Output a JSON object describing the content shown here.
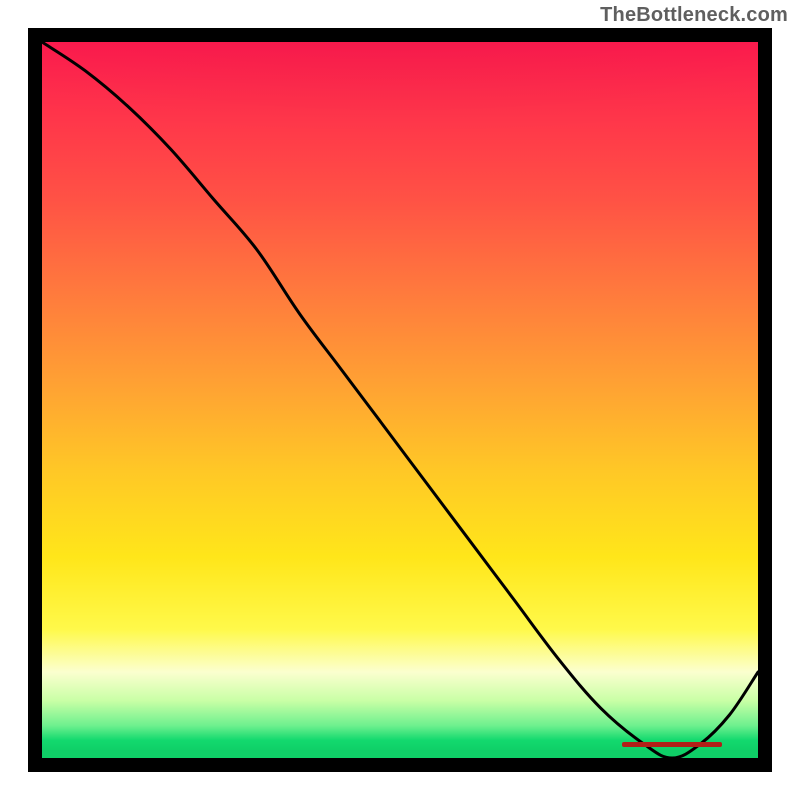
{
  "attribution": "TheBottleneck.com",
  "chart_data": {
    "type": "line",
    "title": "",
    "xlabel": "",
    "ylabel": "",
    "xlim": [
      0,
      100
    ],
    "ylim": [
      0,
      100
    ],
    "x": [
      0,
      6,
      12,
      18,
      24,
      30,
      36,
      42,
      48,
      54,
      60,
      66,
      72,
      78,
      84,
      88,
      92,
      96,
      100
    ],
    "values": [
      100,
      96,
      91,
      85,
      78,
      71,
      62,
      54,
      46,
      38,
      30,
      22,
      14,
      7,
      2,
      0,
      2,
      6,
      12
    ],
    "annotations": [
      {
        "label": "",
        "x": 85,
        "y": 0
      }
    ],
    "background_gradient_top": "#ff1a4e",
    "background_gradient_bottom": "#0fcf67",
    "curve_color": "#000000",
    "annotation_color": "#b22018"
  },
  "colors": {
    "attribution_text": "#5f5f5f",
    "border": "#000000"
  }
}
